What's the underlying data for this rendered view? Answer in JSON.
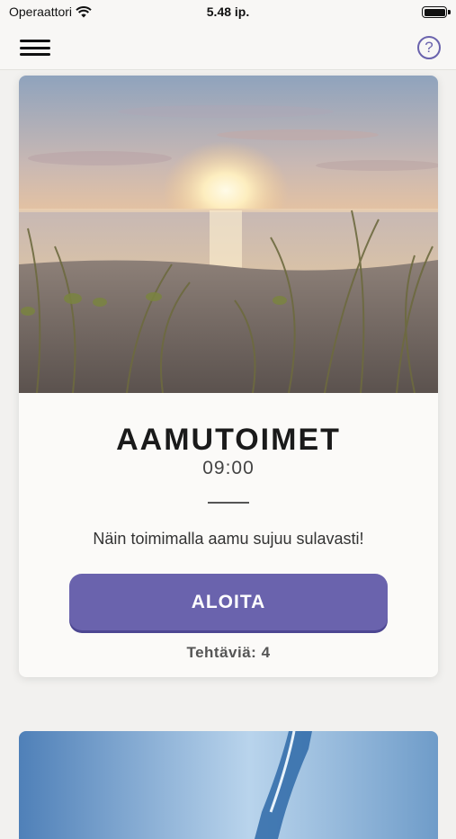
{
  "status_bar": {
    "carrier": "Operaattori",
    "time": "5.48 ip."
  },
  "card": {
    "title": "AAMUTOIMET",
    "time": "09:00",
    "description": "Näin toimimalla aamu sujuu sulavasti!",
    "start_label": "ALOITA",
    "task_count": "Tehtäviä: 4"
  },
  "colors": {
    "accent": "#6a63ad"
  },
  "icons": {
    "menu": "hamburger-menu-icon",
    "help": "question-mark-icon"
  }
}
